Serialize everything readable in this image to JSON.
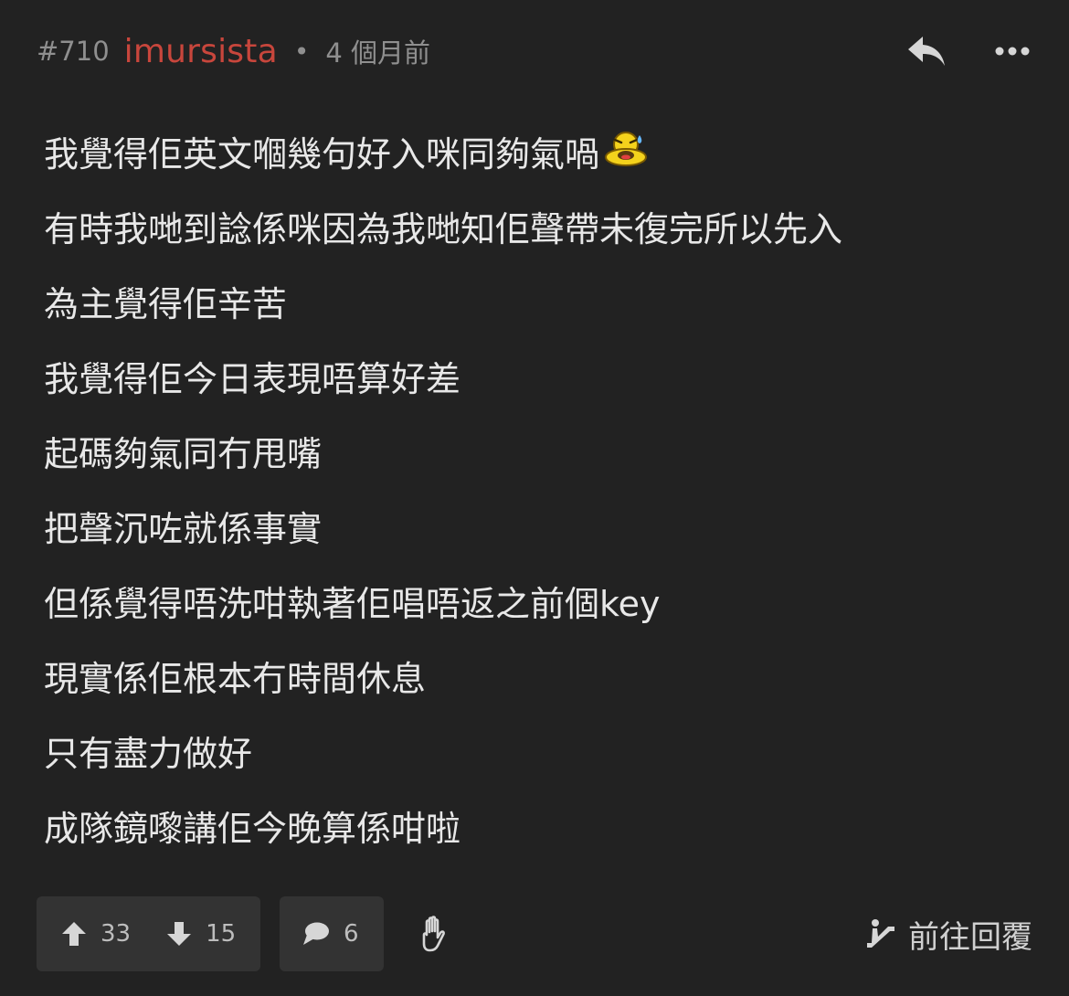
{
  "header": {
    "post_number": "#710",
    "username": "imursista",
    "separator": "•",
    "time": "4 個月前",
    "reply_icon": "reply-arrow-icon",
    "more_icon": "more-dots-icon",
    "username_color": "#c8463c"
  },
  "content": {
    "lines": [
      "我覺得佢英文嗰幾句好入咪同夠氣喎",
      "有時我哋到諗係咪因為我哋知佢聲帶未復完所以先入",
      "為主覺得佢辛苦",
      "我覺得佢今日表現唔算好差",
      "起碼夠氣同冇甩嘴",
      "把聲沉咗就係事實",
      "但係覺得唔洗咁執著佢唱唔返之前個key",
      "現實係佢根本冇時間休息",
      "只有盡力做好",
      "成隊鏡嚟講佢今晚算係咁啦"
    ],
    "emoji": "sweat-emoji-icon"
  },
  "footer": {
    "upvotes": "33",
    "downvotes": "15",
    "comments": "6",
    "goto_reply_label": "前往回覆",
    "upvote_icon": "arrow-up-icon",
    "downvote_icon": "arrow-down-icon",
    "comment_icon": "comment-bubble-icon",
    "hand_icon": "raised-hand-icon",
    "goto_icon": "escalator-icon"
  }
}
